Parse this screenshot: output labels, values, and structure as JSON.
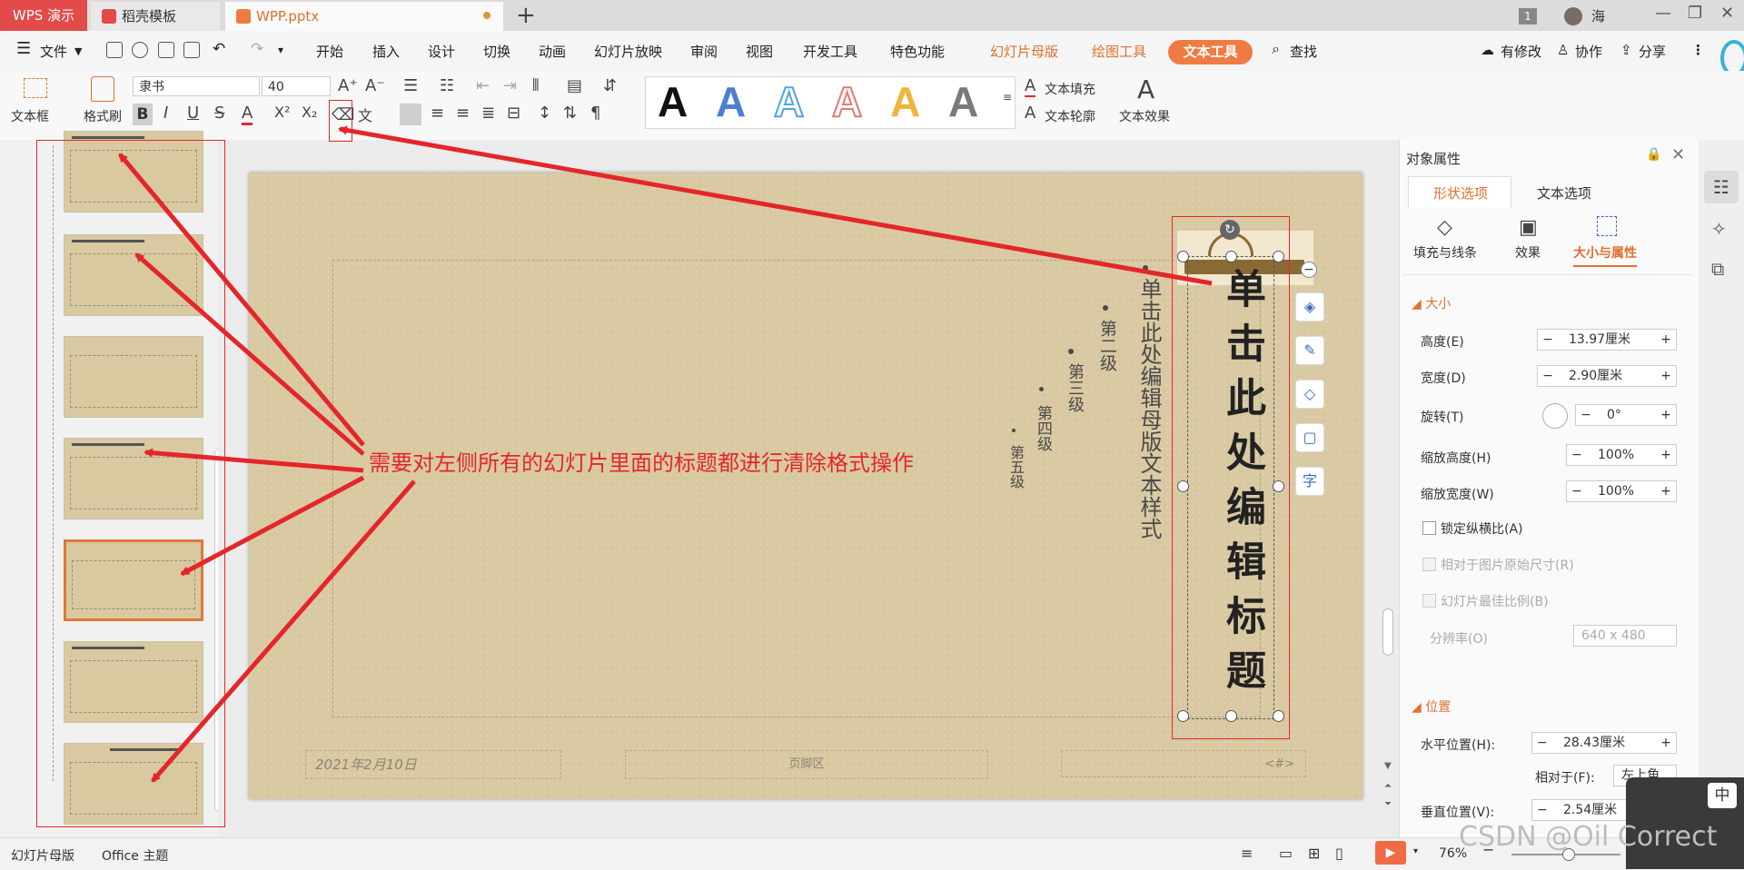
{
  "titlebar": {
    "app_name": "WPS 演示",
    "tabs": [
      {
        "label": "稻壳模板"
      },
      {
        "label": "WPP.pptx"
      }
    ],
    "new_tab": "+",
    "window_count": "1",
    "user_name": "海"
  },
  "menu": {
    "file": "文件",
    "items": [
      "开始",
      "插入",
      "设计",
      "切换",
      "动画",
      "幻灯片放映",
      "审阅",
      "视图",
      "开发工具",
      "特色功能"
    ],
    "context_items": [
      "幻灯片母版",
      "绘图工具"
    ],
    "active": "文本工具",
    "search": "查找",
    "right": [
      "有修改",
      "协作",
      "分享"
    ]
  },
  "ribbon": {
    "textbox_label": "文本框",
    "format_painter_label": "格式刷",
    "font_name": "隶书",
    "font_size": "40",
    "bold": "B",
    "italic": "I",
    "underline": "U",
    "strike": "S",
    "font_color": "A",
    "superscript": "X²",
    "subscript": "X₂",
    "wen": "文",
    "style_letter": "A",
    "text_fill": "文本填充",
    "text_outline": "文本轮廓",
    "text_effect": "文本效果"
  },
  "slide": {
    "title": "单击此处编辑标题",
    "body_main": "单击此处编辑母版文本样式",
    "levels": [
      "第二级",
      "第三级",
      "第四级",
      "第五级"
    ],
    "date": "2021年2月10日",
    "footer": "页脚区",
    "page_num": "<#>"
  },
  "annotation": "需要对左侧所有的幻灯片里面的标题都进行清除格式操作",
  "panel": {
    "title": "对象属性",
    "tabs": [
      "形状选项",
      "文本选项"
    ],
    "subtabs": [
      "填充与线条",
      "效果",
      "大小与属性"
    ],
    "section_size": "大小",
    "height_label": "高度(E)",
    "height_value": "13.97厘米",
    "width_label": "宽度(D)",
    "width_value": "2.90厘米",
    "rotate_label": "旋转(T)",
    "rotate_value": "0°",
    "scale_h_label": "缩放高度(H)",
    "scale_h_value": "100%",
    "scale_w_label": "缩放宽度(W)",
    "scale_w_value": "100%",
    "lock_ratio": "锁定纵横比(A)",
    "relative_original": "相对于图片原始尺寸(R)",
    "best_scale": "幻灯片最佳比例(B)",
    "resolution_label": "分辨率(O)",
    "resolution_value": "640 x 480",
    "section_position": "位置",
    "hpos_label": "水平位置(H):",
    "hpos_value": "28.43厘米",
    "relative_label": "相对于(F):",
    "relative_value": "左上角",
    "vpos_label": "垂直位置(V):",
    "vpos_value": "2.54厘米"
  },
  "status": {
    "mode": "幻灯片母版",
    "theme": "Office 主题",
    "zoom": "76%"
  },
  "ime": {
    "label": "中"
  },
  "watermark": "CSDN @Oil Correct"
}
